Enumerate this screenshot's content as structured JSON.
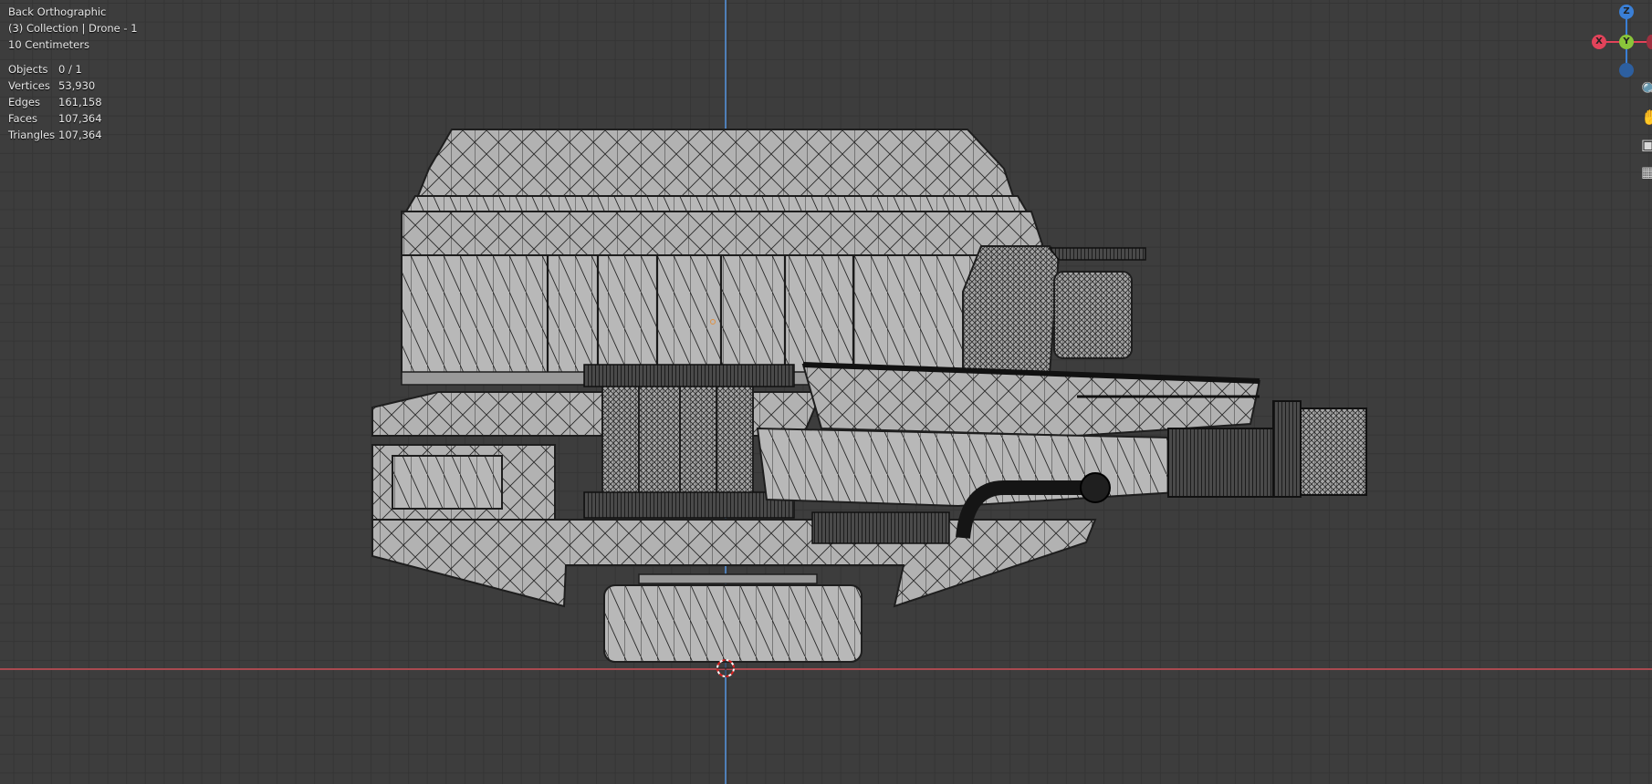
{
  "viewport": {
    "view_name": "Back Orthographic",
    "collection": "(3) Collection | Drone - 1",
    "scale": "10 Centimeters"
  },
  "stats": [
    {
      "label": "Objects",
      "value": "0 / 1"
    },
    {
      "label": "Vertices",
      "value": "53,930"
    },
    {
      "label": "Edges",
      "value": "161,158"
    },
    {
      "label": "Faces",
      "value": "107,364"
    },
    {
      "label": "Triangles",
      "value": "107,364"
    }
  ],
  "gizmo": {
    "z_label": "Z",
    "y_label": "Y",
    "x_label": "X",
    "colors": {
      "x": "#e2435a",
      "y": "#8ac53a",
      "z": "#3a7fd6"
    }
  },
  "tool_icons": [
    "magnify-icon",
    "hand-icon",
    "camera-icon",
    "grid-icon"
  ],
  "colors": {
    "background": "#3d3d3d",
    "mesh_fill": "#b4b4b4",
    "wire": "#1e1e1e",
    "axis_z": "#4f7fb8",
    "axis_x": "#a94a50"
  }
}
